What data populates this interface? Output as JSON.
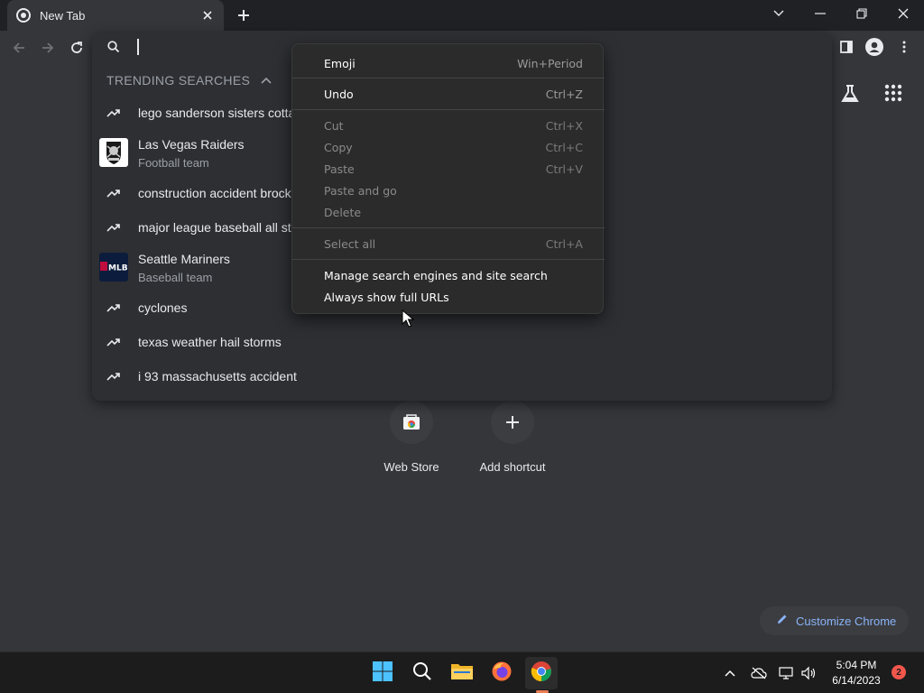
{
  "tab": {
    "title": "New Tab"
  },
  "omnibox": {
    "value": ""
  },
  "trending": {
    "header": "TRENDING SEARCHES",
    "suggestions": [
      {
        "type": "search",
        "text": "lego sanderson sisters cottage"
      },
      {
        "type": "entity",
        "title": "Las Vegas Raiders",
        "subtitle": "Football team"
      },
      {
        "type": "search",
        "text": "construction accident brockton"
      },
      {
        "type": "search",
        "text": "major league baseball all star"
      },
      {
        "type": "entity",
        "title": "Seattle Mariners",
        "subtitle": "Baseball team"
      },
      {
        "type": "search",
        "text": "cyclones"
      },
      {
        "type": "search",
        "text": "texas weather hail storms"
      },
      {
        "type": "search",
        "text": "i 93 massachusetts accident"
      }
    ]
  },
  "context_menu": {
    "items": [
      {
        "label": "Emoji",
        "shortcut": "Win+Period",
        "enabled": true
      },
      {
        "label": "Undo",
        "shortcut": "Ctrl+Z",
        "enabled": true
      },
      {
        "label": "Cut",
        "shortcut": "Ctrl+X",
        "enabled": false
      },
      {
        "label": "Copy",
        "shortcut": "Ctrl+C",
        "enabled": false
      },
      {
        "label": "Paste",
        "shortcut": "Ctrl+V",
        "enabled": false
      },
      {
        "label": "Paste and go",
        "shortcut": "",
        "enabled": false
      },
      {
        "label": "Delete",
        "shortcut": "",
        "enabled": false
      },
      {
        "label": "Select all",
        "shortcut": "Ctrl+A",
        "enabled": false
      },
      {
        "label": "Manage search engines and site search",
        "shortcut": "",
        "enabled": true
      },
      {
        "label": "Always show full URLs",
        "shortcut": "",
        "enabled": true
      }
    ]
  },
  "shortcuts": [
    {
      "label": "Web Store",
      "icon": "web-store-icon"
    },
    {
      "label": "Add shortcut",
      "icon": "plus-icon"
    }
  ],
  "customize": {
    "label": "Customize Chrome"
  },
  "taskbar": {
    "time": "5:04 PM",
    "date": "6/14/2023",
    "notification_count": "2"
  },
  "colors": {
    "background": "#35363a",
    "accent_link": "#8ab4f8",
    "notification": "#f2574c"
  }
}
